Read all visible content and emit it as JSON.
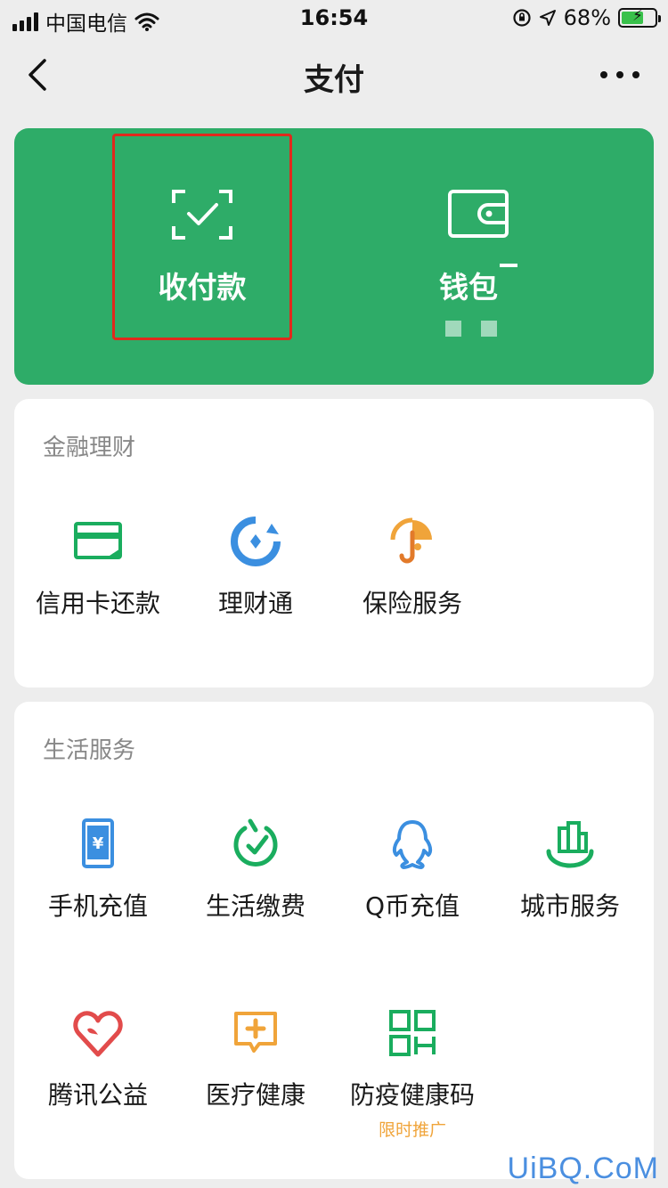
{
  "status_bar": {
    "carrier": "中国电信",
    "time": "16:54",
    "battery_percent": "68%",
    "battery_level": 0.68
  },
  "nav": {
    "title": "支付"
  },
  "top_card": {
    "color": "#2eac68",
    "items": [
      {
        "label": "收付款",
        "icon": "scan-pay-icon"
      },
      {
        "label": "钱包",
        "icon": "wallet-icon"
      }
    ]
  },
  "finance": {
    "title": "金融理财",
    "items": [
      {
        "label": "信用卡还款",
        "icon": "credit-card-icon"
      },
      {
        "label": "理财通",
        "icon": "wealth-icon"
      },
      {
        "label": "保险服务",
        "icon": "insurance-icon"
      }
    ]
  },
  "life": {
    "title": "生活服务",
    "items": [
      {
        "label": "手机充值",
        "icon": "phone-recharge-icon"
      },
      {
        "label": "生活缴费",
        "icon": "utility-icon"
      },
      {
        "label": "Q币充值",
        "icon": "qq-icon"
      },
      {
        "label": "城市服务",
        "icon": "city-icon"
      },
      {
        "label": "腾讯公益",
        "icon": "charity-icon"
      },
      {
        "label": "医疗健康",
        "icon": "medical-icon"
      },
      {
        "label": "防疫健康码",
        "icon": "qr-code-icon",
        "badge": "限时推广"
      }
    ]
  },
  "watermark": "UiBQ.CoM"
}
